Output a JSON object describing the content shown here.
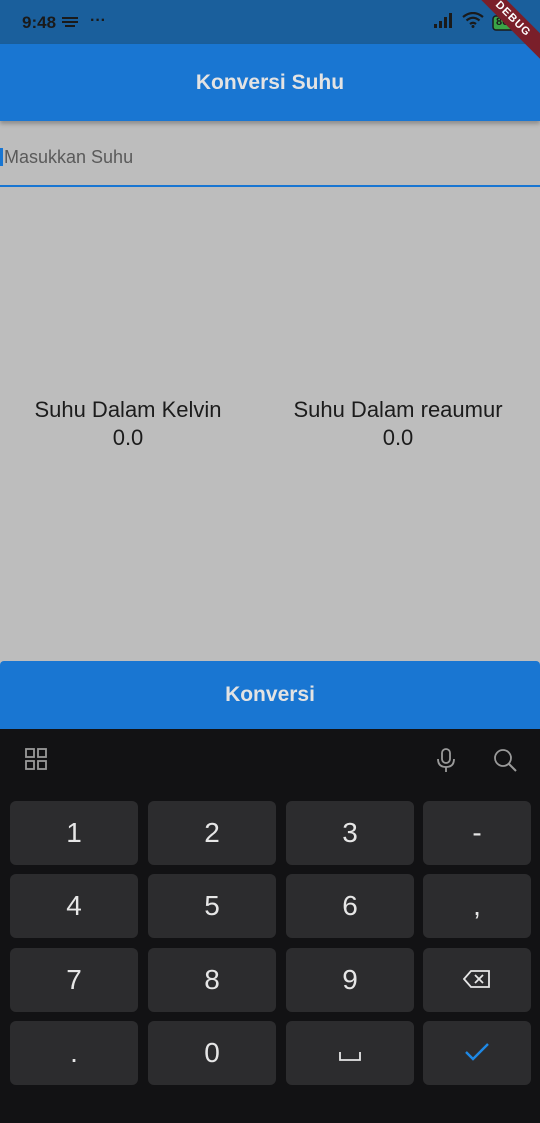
{
  "status_bar": {
    "time": "9:48",
    "more": "···",
    "battery": "80"
  },
  "app_bar": {
    "title": "Konversi Suhu",
    "debug_banner": "DEBUG"
  },
  "input": {
    "placeholder": "Masukkan Suhu",
    "value": ""
  },
  "results": {
    "kelvin": {
      "label": "Suhu Dalam Kelvin",
      "value": "0.0"
    },
    "reaumur": {
      "label": "Suhu Dalam reaumur",
      "value": "0.0"
    }
  },
  "button": {
    "label": "Konversi"
  },
  "keyboard": {
    "keys": {
      "k1": "1",
      "k2": "2",
      "k3": "3",
      "minus": "-",
      "k4": "4",
      "k5": "5",
      "k6": "6",
      "comma": ",",
      "k7": "7",
      "k8": "8",
      "k9": "9",
      "dot": ".",
      "k0": "0"
    }
  },
  "colors": {
    "primary": "#1976d2",
    "status_bar": "#1a5f9c",
    "background": "#bdbdbd",
    "keyboard_bg": "#121214",
    "key_bg": "#2c2c2e"
  }
}
